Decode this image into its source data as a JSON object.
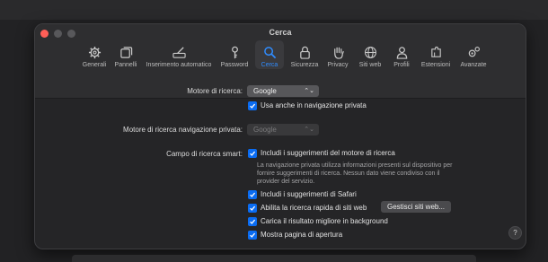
{
  "window": {
    "title": "Cerca"
  },
  "tabs": [
    {
      "label": "Generali",
      "icon": "gear-icon"
    },
    {
      "label": "Pannelli",
      "icon": "tabs-icon"
    },
    {
      "label": "Inserimento automatico",
      "icon": "pencil-field-icon"
    },
    {
      "label": "Password",
      "icon": "key-icon"
    },
    {
      "label": "Cerca",
      "icon": "magnifier-icon",
      "active": true
    },
    {
      "label": "Sicurezza",
      "icon": "lock-icon"
    },
    {
      "label": "Privacy",
      "icon": "hand-icon"
    },
    {
      "label": "Siti web",
      "icon": "globe-icon"
    },
    {
      "label": "Profili",
      "icon": "person-icon"
    },
    {
      "label": "Estensioni",
      "icon": "puzzle-icon"
    },
    {
      "label": "Avanzate",
      "icon": "gears-icon"
    }
  ],
  "search_engine": {
    "label": "Motore di ricerca:",
    "value": "Google"
  },
  "private_use": {
    "label": "Usa anche in navigazione privata",
    "checked": true
  },
  "private_engine": {
    "label": "Motore di ricerca navigazione privata:",
    "value": "Google",
    "disabled": true
  },
  "smart_search": {
    "label": "Campo di ricerca smart:",
    "options": [
      {
        "label": "Includi i suggerimenti del motore di ricerca",
        "checked": true
      },
      {
        "label": "Includi i suggerimenti di Safari",
        "checked": true
      },
      {
        "label": "Abilita la ricerca rapida di siti web",
        "checked": true
      },
      {
        "label": "Carica il risultato migliore in background",
        "checked": true
      },
      {
        "label": "Mostra pagina di apertura",
        "checked": true
      }
    ],
    "note": "La navigazione privata utilizza informazioni presenti sul dispositivo per fornire suggerimenti di ricerca. Nessun dato viene condiviso con il provider del servizio.",
    "manage_button": "Gestisci siti web..."
  },
  "help": {
    "label": "?"
  },
  "colors": {
    "accent": "#0a6cf2",
    "active_tab": "#2f8cff",
    "close": "#ff5f57"
  }
}
